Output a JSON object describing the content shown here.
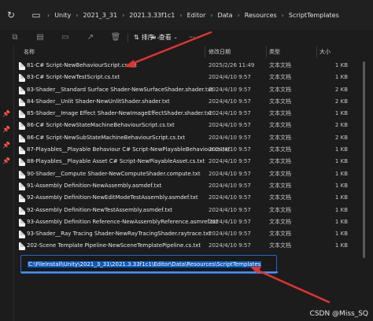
{
  "address_bar": {
    "crumbs": [
      "Unity",
      "2021_3_31",
      "2021.3.33f1c1",
      "Editor",
      "Data",
      "Resources",
      "ScriptTemplates"
    ]
  },
  "toolbar": {
    "sort_label": "排序",
    "view_label": "查看",
    "more_label": "···"
  },
  "columns": {
    "name": "名称",
    "date": "修改日期",
    "type": "类型",
    "size": "大小"
  },
  "files": [
    {
      "name": "81-C# Script-NewBehaviourScript.cs.txt",
      "date": "2025/2/26 11:49",
      "type": "文本文档",
      "size": "1 KB"
    },
    {
      "name": "83-C# Script-NewTestScript.cs.txt",
      "date": "2024/4/10 9:57",
      "type": "文本文档",
      "size": "1 KB"
    },
    {
      "name": "83-Shader__Standard Surface Shader-NewSurfaceShader.shader.txt",
      "date": "2024/4/10 9:57",
      "type": "文本文档",
      "size": "2 KB"
    },
    {
      "name": "84-Shader__Unlit Shader-NewUnlitShader.shader.txt",
      "date": "2024/4/10 9:57",
      "type": "文本文档",
      "size": "2 KB"
    },
    {
      "name": "85-Shader__Image Effect Shader-NewImageEffectShader.shader.txt",
      "date": "2024/4/10 9:57",
      "type": "文本文档",
      "size": "1 KB"
    },
    {
      "name": "86-C# Script-NewStateMachineBehaviourScript.cs.txt",
      "date": "2024/4/10 9:57",
      "type": "文本文档",
      "size": "2 KB"
    },
    {
      "name": "86-C# Script-NewSubStateMachineBehaviourScript.cs.txt",
      "date": "2024/4/10 9:57",
      "type": "文本文档",
      "size": "2 KB"
    },
    {
      "name": "87-Playables__Playable Behaviour C# Script-NewPlayableBehaviour.cs.txt",
      "date": "2024/4/10 9:57",
      "type": "文本文档",
      "size": "1 KB"
    },
    {
      "name": "88-Playables__Playable Asset C# Script-NewPlayableAsset.cs.txt",
      "date": "2024/4/10 9:57",
      "type": "文本文档",
      "size": "1 KB"
    },
    {
      "name": "90-Shader__Compute Shader-NewComputeShader.compute.txt",
      "date": "2024/4/10 9:57",
      "type": "文本文档",
      "size": "1 KB"
    },
    {
      "name": "91-Assembly Definition-NewAssembly.asmdef.txt",
      "date": "2024/4/10 9:57",
      "type": "文本文档",
      "size": "1 KB"
    },
    {
      "name": "92-Assembly Definition-NewEditModeTestAssembly.asmdef.txt",
      "date": "2024/4/10 9:57",
      "type": "文本文档",
      "size": "1 KB"
    },
    {
      "name": "92-Assembly Definition-NewTestAssembly.asmdef.txt",
      "date": "2024/4/10 9:57",
      "type": "文本文档",
      "size": "1 KB"
    },
    {
      "name": "93-Assembly Definition Reference-NewAssemblyReference.asmref.txt",
      "date": "2024/4/10 9:57",
      "type": "文本文档",
      "size": "1 KB"
    },
    {
      "name": "93-Shader__Ray Tracing Shader-NewRayTracingShader.raytrace.txt",
      "date": "2024/4/10 9:57",
      "type": "文本文档",
      "size": "1 KB"
    },
    {
      "name": "202-Scene Template Pipeline-NewSceneTemplatePipeline.cs.txt",
      "date": "2024/4/10 9:57",
      "type": "文本文档",
      "size": "1 KB"
    }
  ],
  "path_input": {
    "value": "C:\\FileInstall\\Unity\\2021_3_31\\2021.3.33f1c1\\Editor\\Data\\Resources\\ScriptTemplates"
  },
  "watermark": "CSDN @Miss_SQ",
  "colors": {
    "background": "#1c1c1c",
    "accent": "#2c64c8",
    "annotation_arrow": "#e0342f"
  }
}
